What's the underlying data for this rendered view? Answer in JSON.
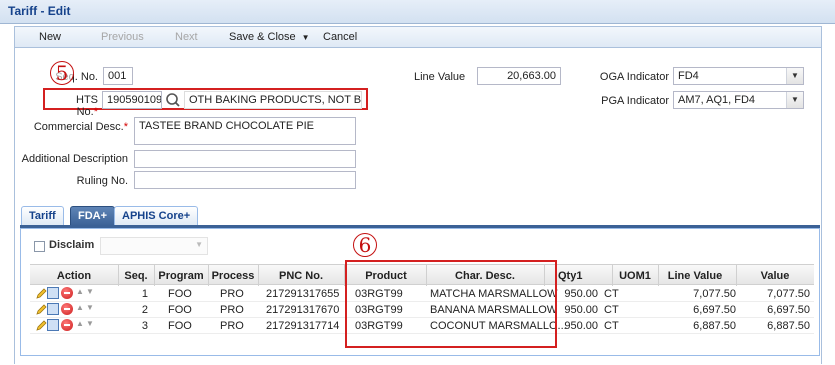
{
  "window": {
    "title": "Tariff - Edit"
  },
  "toolbar": {
    "new_label": "New",
    "previous_label": "Previous",
    "next_label": "Next",
    "save_close_label": "Save & Close",
    "cancel_label": "Cancel"
  },
  "form": {
    "seq_label": "Seq. No.",
    "seq_value": "001",
    "hts_label": "HTS No.",
    "hts_value": "1905901090",
    "hts_desc": "OTH BAKING PRODUCTS, NOT BREAD",
    "line_value_label": "Line Value",
    "line_value": "20,663.00",
    "oga_label": "OGA Indicator",
    "oga_value": "FD4",
    "pga_label": "PGA Indicator",
    "pga_value": "AM7, AQ1, FD4",
    "commercial_desc_label": "Commercial Desc.",
    "commercial_desc_value": "TASTEE BRAND CHOCOLATE PIE",
    "additional_desc_label": "Additional Description",
    "additional_desc_value": "",
    "ruling_label": "Ruling No.",
    "ruling_value": "",
    "required_mark": "*"
  },
  "annotations": {
    "five": "5",
    "six": "6"
  },
  "tabs": [
    {
      "label": "Tariff"
    },
    {
      "label": "FDA+"
    },
    {
      "label": "APHIS Core+"
    }
  ],
  "fda": {
    "disclaim_label": "Disclaim"
  },
  "grid": {
    "headers": [
      "Action",
      "Seq.",
      "Program",
      "Process",
      "PNC No.",
      "Product",
      "Char. Desc.",
      "Qty1",
      "UOM1",
      "Line Value",
      "Value"
    ],
    "rows": [
      {
        "seq": "1",
        "program": "FOO",
        "process": "PRO",
        "pnc": "217291317655",
        "product": "03RGT99",
        "char_desc": "MATCHA MARSMALLOW",
        "qty1": "950.00",
        "uom1": "CT",
        "line_value": "7,077.50",
        "value": "7,077.50"
      },
      {
        "seq": "2",
        "program": "FOO",
        "process": "PRO",
        "pnc": "217291317670",
        "product": "03RGT99",
        "char_desc": "BANANA MARSMALLOW",
        "qty1": "950.00",
        "uom1": "CT",
        "line_value": "6,697.50",
        "value": "6,697.50"
      },
      {
        "seq": "3",
        "program": "FOO",
        "process": "PRO",
        "pnc": "217291317714",
        "product": "03RGT99",
        "char_desc": "COCONUT MARSMALLO...",
        "qty1": "950.00",
        "uom1": "CT",
        "line_value": "6,887.50",
        "value": "6,887.50"
      }
    ]
  },
  "icons": [
    "pencil-icon",
    "detail-grid-icon",
    "delete-icon",
    "move-up-icon",
    "move-down-icon",
    "search-icon",
    "chevron-down-icon"
  ],
  "colors": {
    "annotation_red": "#d42020",
    "active_tab": "#3b6196",
    "title_blue": "#15428b"
  }
}
